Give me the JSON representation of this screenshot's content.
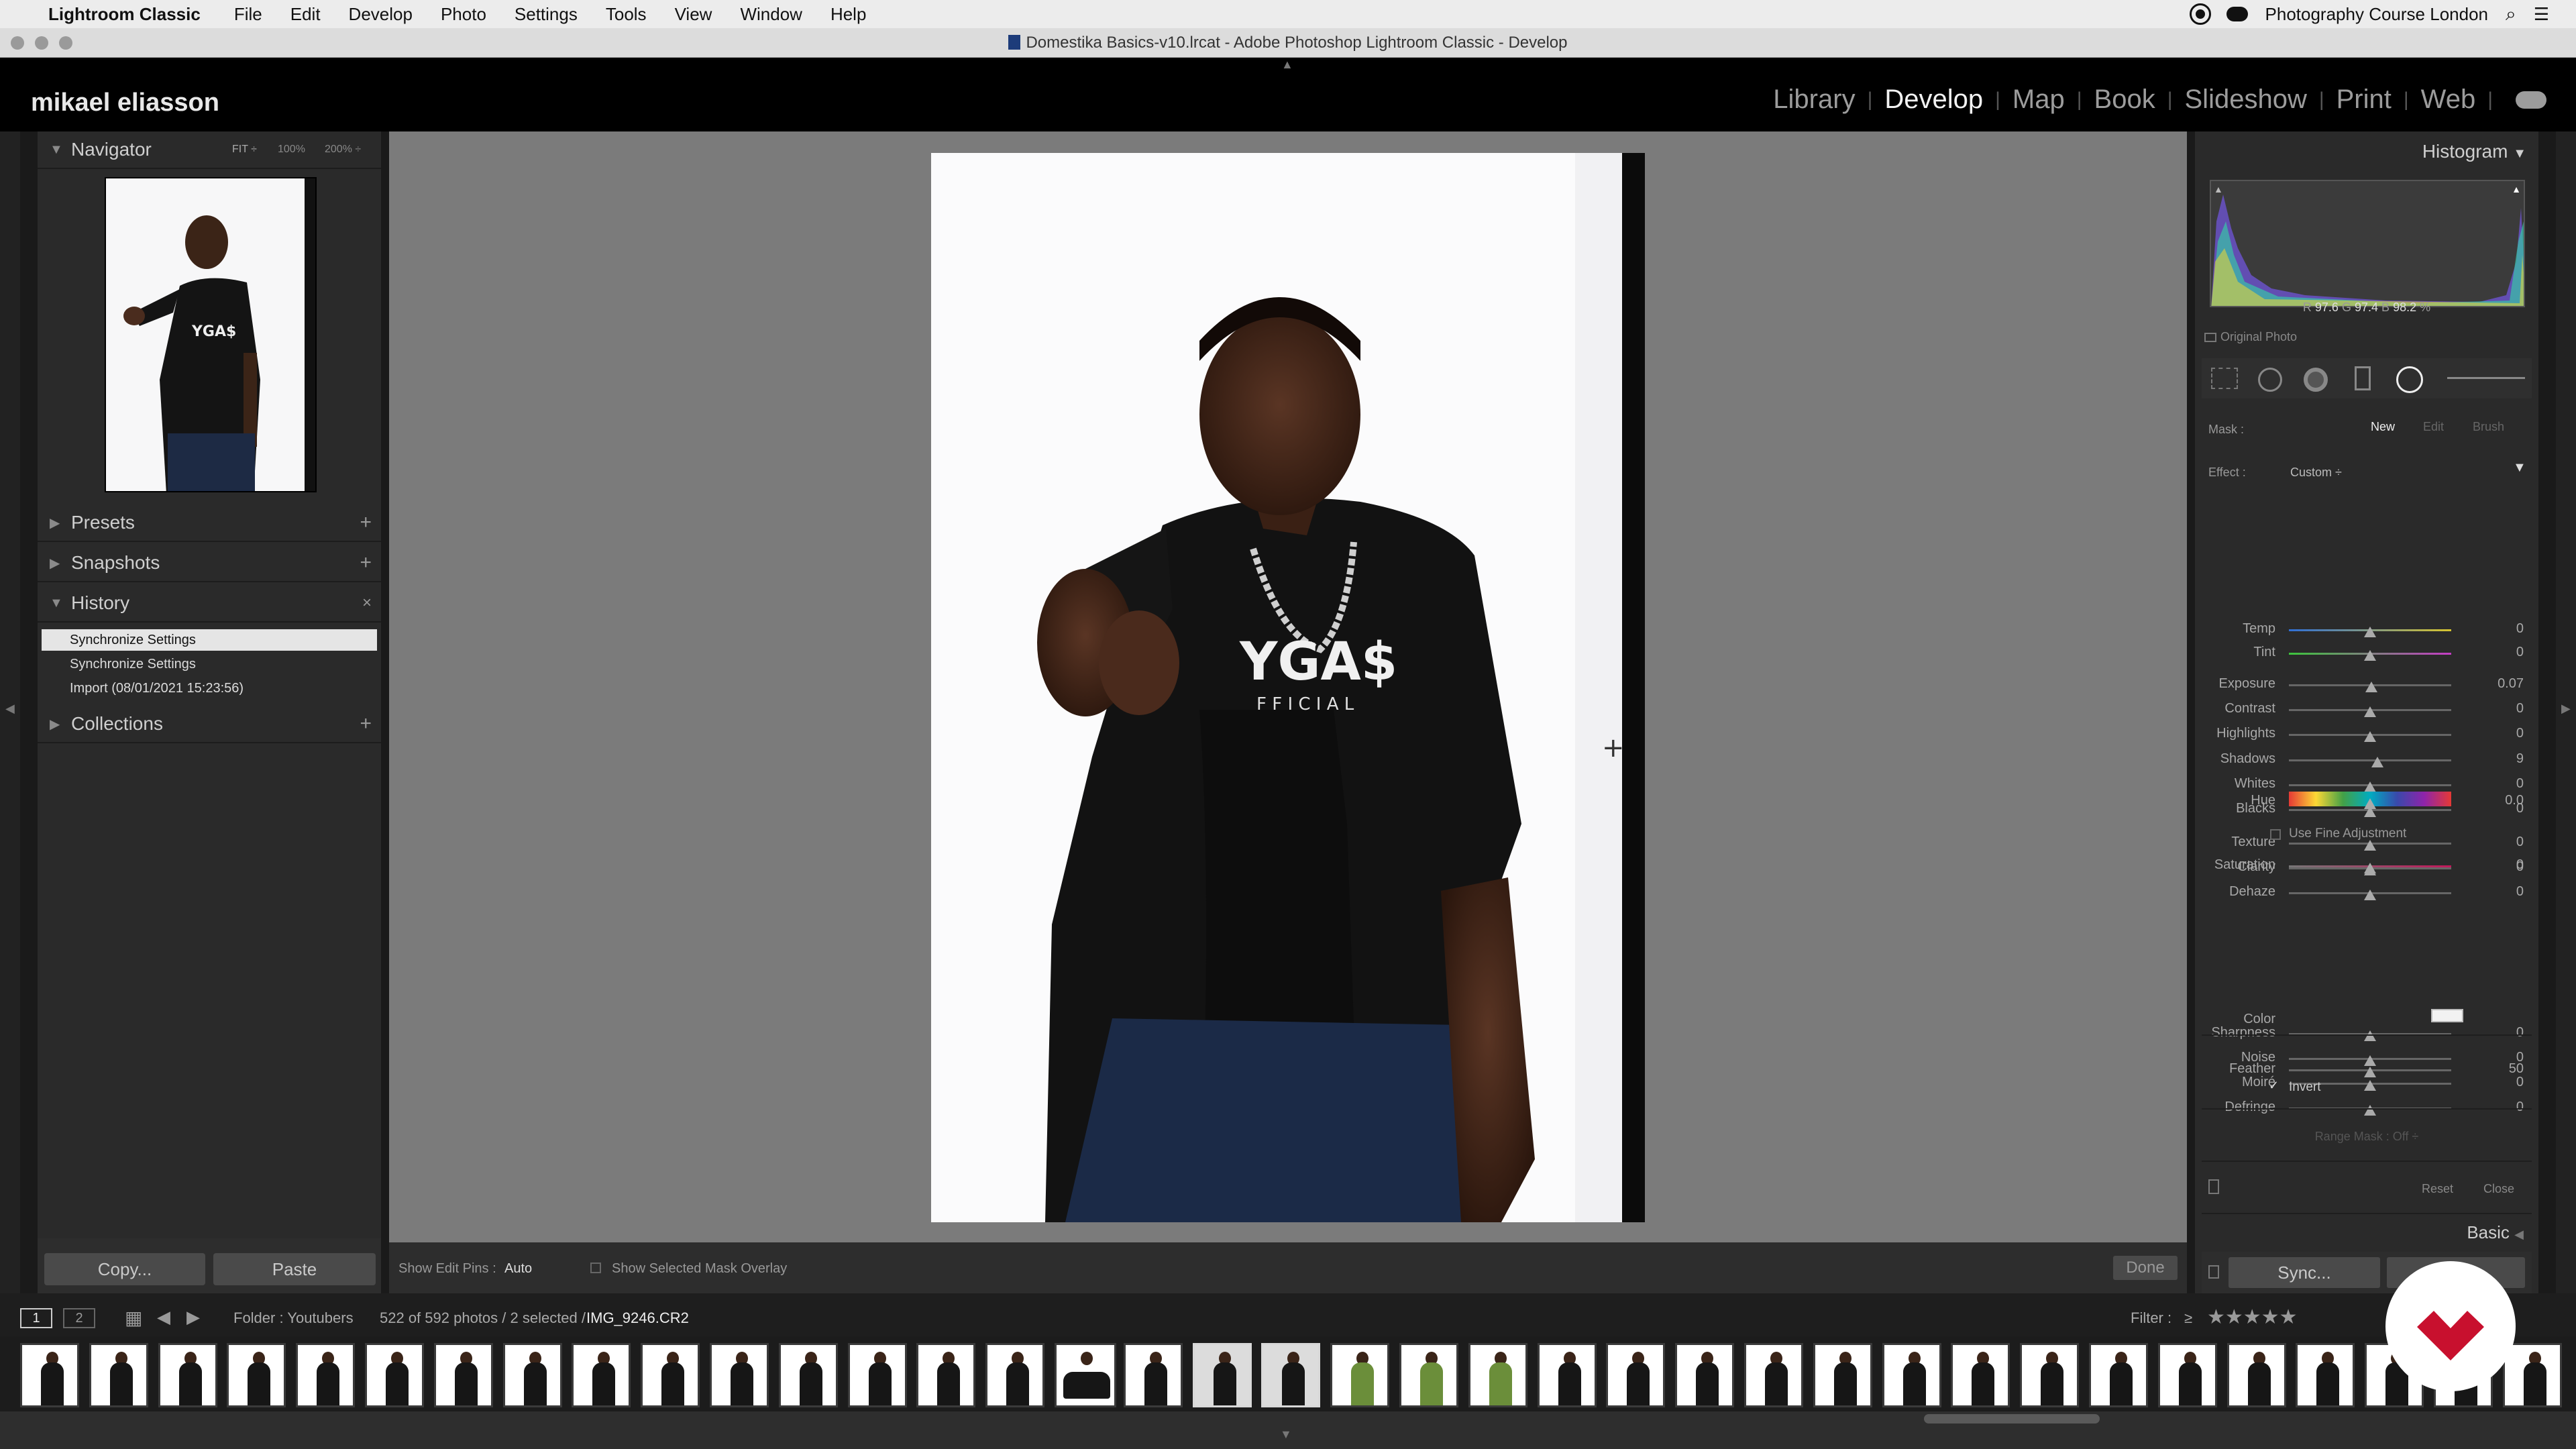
{
  "menubar": {
    "app_name": "Lightroom Classic",
    "items": [
      "File",
      "Edit",
      "Develop",
      "Photo",
      "Settings",
      "Tools",
      "View",
      "Window",
      "Help"
    ],
    "right_label": "Photography Course London"
  },
  "window": {
    "title": "Domestika Basics-v10.lrcat - Adobe Photoshop Lightroom Classic - Develop"
  },
  "identity": {
    "name": "mikael eliasson",
    "modules": [
      "Library",
      "Develop",
      "Map",
      "Book",
      "Slideshow",
      "Print",
      "Web"
    ],
    "active_module": "Develop"
  },
  "left_panel": {
    "navigator": {
      "title": "Navigator",
      "zoom_options": [
        "FIT ÷",
        "100%",
        "200% ÷"
      ]
    },
    "presets": "Presets",
    "snapshots": "Snapshots",
    "history": {
      "title": "History",
      "items": [
        "Synchronize Settings",
        "Synchronize Settings",
        "Import (08/01/2021 15:23:56)"
      ]
    },
    "collections": "Collections",
    "copy_label": "Copy...",
    "paste_label": "Paste"
  },
  "toolbar": {
    "show_edit_pins_label": "Show Edit Pins :",
    "show_edit_pins_value": "Auto",
    "overlay_label": "Show Selected Mask Overlay",
    "done_label": "Done"
  },
  "photo": {
    "shirt_text": "YGA$",
    "shirt_subtext": "F F I C I A L"
  },
  "right_panel": {
    "histogram_title": "Histogram",
    "rgb": {
      "r_label": "R",
      "r": "97.6",
      "g_label": "G",
      "g": "97.4",
      "b_label": "B",
      "b": "98.2",
      "unit": "%"
    },
    "original_photo": "Original Photo",
    "mask_label": "Mask :",
    "mask_new": "New",
    "mask_edit": "Edit",
    "mask_brush": "Brush",
    "effect_label": "Effect :",
    "effect_value": "Custom ÷",
    "sliders": [
      {
        "label": "Temp",
        "value": "0",
        "pos": 0.5
      },
      {
        "label": "Tint",
        "value": "0",
        "pos": 0.5
      },
      {
        "label": "Exposure",
        "value": "0.07",
        "pos": 0.51
      },
      {
        "label": "Contrast",
        "value": "0",
        "pos": 0.5
      },
      {
        "label": "Highlights",
        "value": "0",
        "pos": 0.5
      },
      {
        "label": "Shadows",
        "value": "9",
        "pos": 0.545
      },
      {
        "label": "Whites",
        "value": "0",
        "pos": 0.5
      },
      {
        "label": "Blacks",
        "value": "0",
        "pos": 0.5
      },
      {
        "label": "Texture",
        "value": "0",
        "pos": 0.5
      },
      {
        "label": "Clarity",
        "value": "0",
        "pos": 0.5
      },
      {
        "label": "Dehaze",
        "value": "0",
        "pos": 0.5
      }
    ],
    "hue_label": "Hue",
    "hue_value": "0.0",
    "use_fine_adjustment": "Use Fine Adjustment",
    "saturation_label": "Saturation",
    "saturation_value": "0",
    "detail_sliders": [
      {
        "label": "Sharpness",
        "value": "0",
        "pos": 0.5
      },
      {
        "label": "Noise",
        "value": "0",
        "pos": 0.5
      },
      {
        "label": "Moiré",
        "value": "0",
        "pos": 0.5
      },
      {
        "label": "Defringe",
        "value": "0",
        "pos": 0.5
      }
    ],
    "color_label": "Color",
    "feather_label": "Feather",
    "feather_value": "50",
    "invert_label": "Invert",
    "range_mask": "Range Mask : Off ÷",
    "reset_label": "Reset",
    "close_label": "Close",
    "basic_label": "Basic",
    "sync_label": "Sync..."
  },
  "filmstrip_bar": {
    "page1": "1",
    "page2": "2",
    "folder": "Folder : Youtubers",
    "count": "522 of 592 photos / 2 selected /",
    "filename": "IMG_9246.CR2",
    "filter_label": "Filter :",
    "filter_op": "≥",
    "stars": "★★★★★"
  },
  "colors": {
    "accent_red": "#c8102e",
    "panel_bg": "#2a2a2a",
    "center_bg": "#7b7b7b"
  }
}
